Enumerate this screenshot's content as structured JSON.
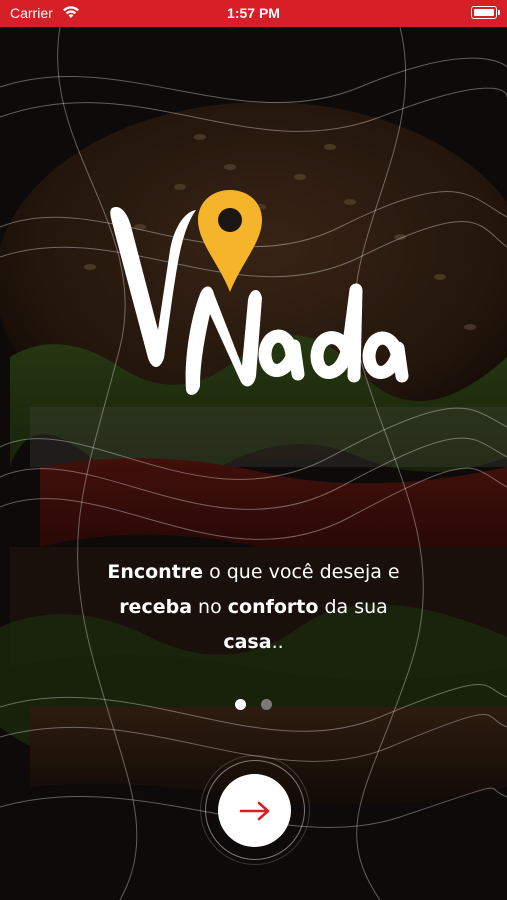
{
  "status_bar": {
    "carrier": "Carrier",
    "time": "1:57 PM"
  },
  "logo": {
    "text": "Vo Nada",
    "accent_color": "#f5b42a"
  },
  "tagline": {
    "part1": "Encontre",
    "part2": " o que você deseja e ",
    "part3": "receba",
    "part4": " no ",
    "part5": "conforto",
    "part6": " da sua ",
    "part7": "casa",
    "part8": ".."
  },
  "pager": {
    "current_page": 1,
    "total_pages": 2
  },
  "next_button": {
    "icon": "arrow-right-icon",
    "color": "#d61f26"
  },
  "colors": {
    "brand_red": "#d61f26",
    "accent_yellow": "#f5b42a"
  }
}
